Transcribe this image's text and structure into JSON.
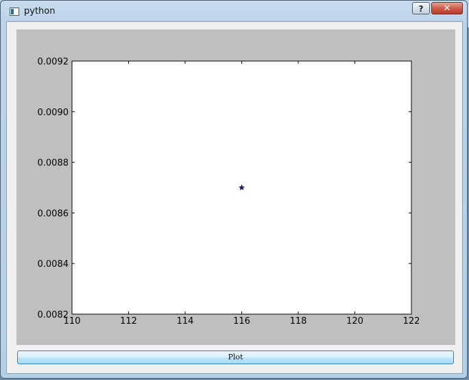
{
  "window": {
    "title": "python",
    "help_label": "?",
    "close_label": "✕"
  },
  "plot_button": {
    "label": "Plot"
  },
  "chart_data": {
    "type": "scatter",
    "marker": "star",
    "x_ticks": [
      "110",
      "112",
      "114",
      "116",
      "118",
      "120",
      "122"
    ],
    "y_ticks": [
      "0.0082",
      "0.0084",
      "0.0086",
      "0.0088",
      "0.0090",
      "0.0092"
    ],
    "xlim": [
      110,
      122
    ],
    "ylim": [
      0.0082,
      0.0092
    ],
    "points": [
      {
        "x": 116,
        "y": 0.0087
      }
    ],
    "colors": {
      "marker": "#1a1a5a",
      "figure_bg": "#bfbfbf",
      "axes_bg": "#ffffff"
    },
    "grid": false
  }
}
